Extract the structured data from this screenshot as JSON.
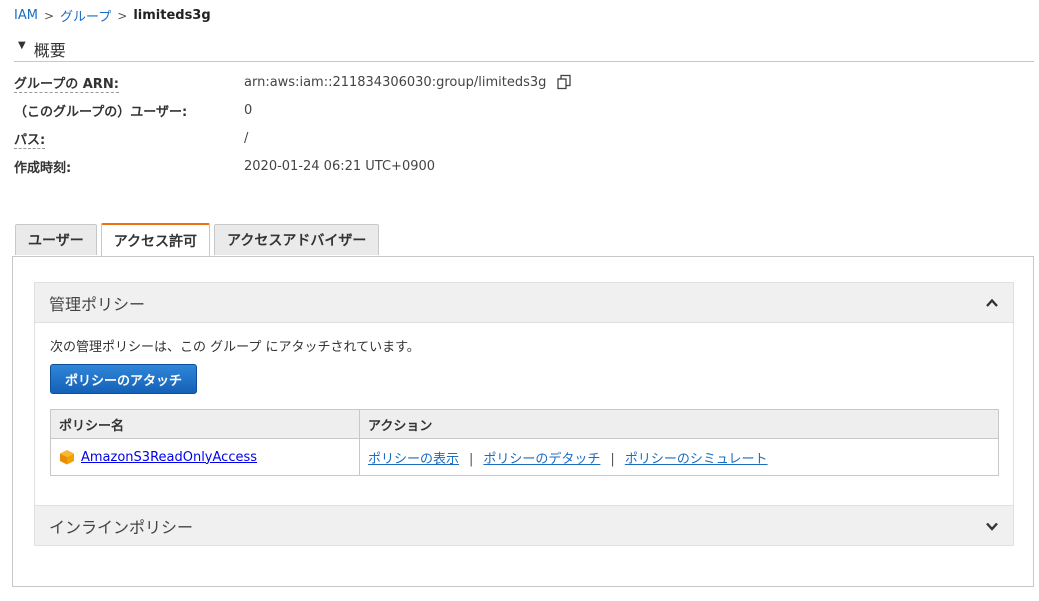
{
  "breadcrumb": {
    "items": [
      "IAM",
      "グループ",
      "limiteds3g"
    ],
    "separator": ">"
  },
  "summary": {
    "title": "概要",
    "rows": [
      {
        "label": "グループの ARN:",
        "value": "arn:aws:iam::211834306030:group/limiteds3g"
      },
      {
        "label": "（このグループの）ユーザー:",
        "value": "0"
      },
      {
        "label": "パス:",
        "value": "/"
      },
      {
        "label": "作成時刻:",
        "value": "2020-01-24 06:21 UTC+0900"
      }
    ]
  },
  "tabs": [
    {
      "label": "ユーザー",
      "active": false
    },
    {
      "label": "アクセス許可",
      "active": true
    },
    {
      "label": "アクセスアドバイザー",
      "active": false
    }
  ],
  "managed": {
    "title": "管理ポリシー",
    "description": "次の管理ポリシーは、この グループ にアタッチされています。",
    "attach_button": "ポリシーのアタッチ",
    "columns": [
      "ポリシー名",
      "アクション"
    ],
    "rows": [
      {
        "name": "AmazonS3ReadOnlyAccess",
        "actions": [
          "ポリシーの表示",
          "ポリシーのデタッチ",
          "ポリシーのシミュレート"
        ],
        "action_separator": "|"
      }
    ]
  },
  "inline": {
    "title": "インラインポリシー"
  },
  "colors": {
    "link": "#1a6dc2",
    "accent_tab": "#ec7211",
    "button": "#1561b8",
    "policy_icon": "#f2a200"
  },
  "icons": {
    "summary_toggle": "caret-down-icon",
    "copy": "copy-icon",
    "managed_toggle": "chevron-up-icon",
    "inline_toggle": "chevron-down-icon",
    "policy": "aws-policy-cube-icon"
  }
}
